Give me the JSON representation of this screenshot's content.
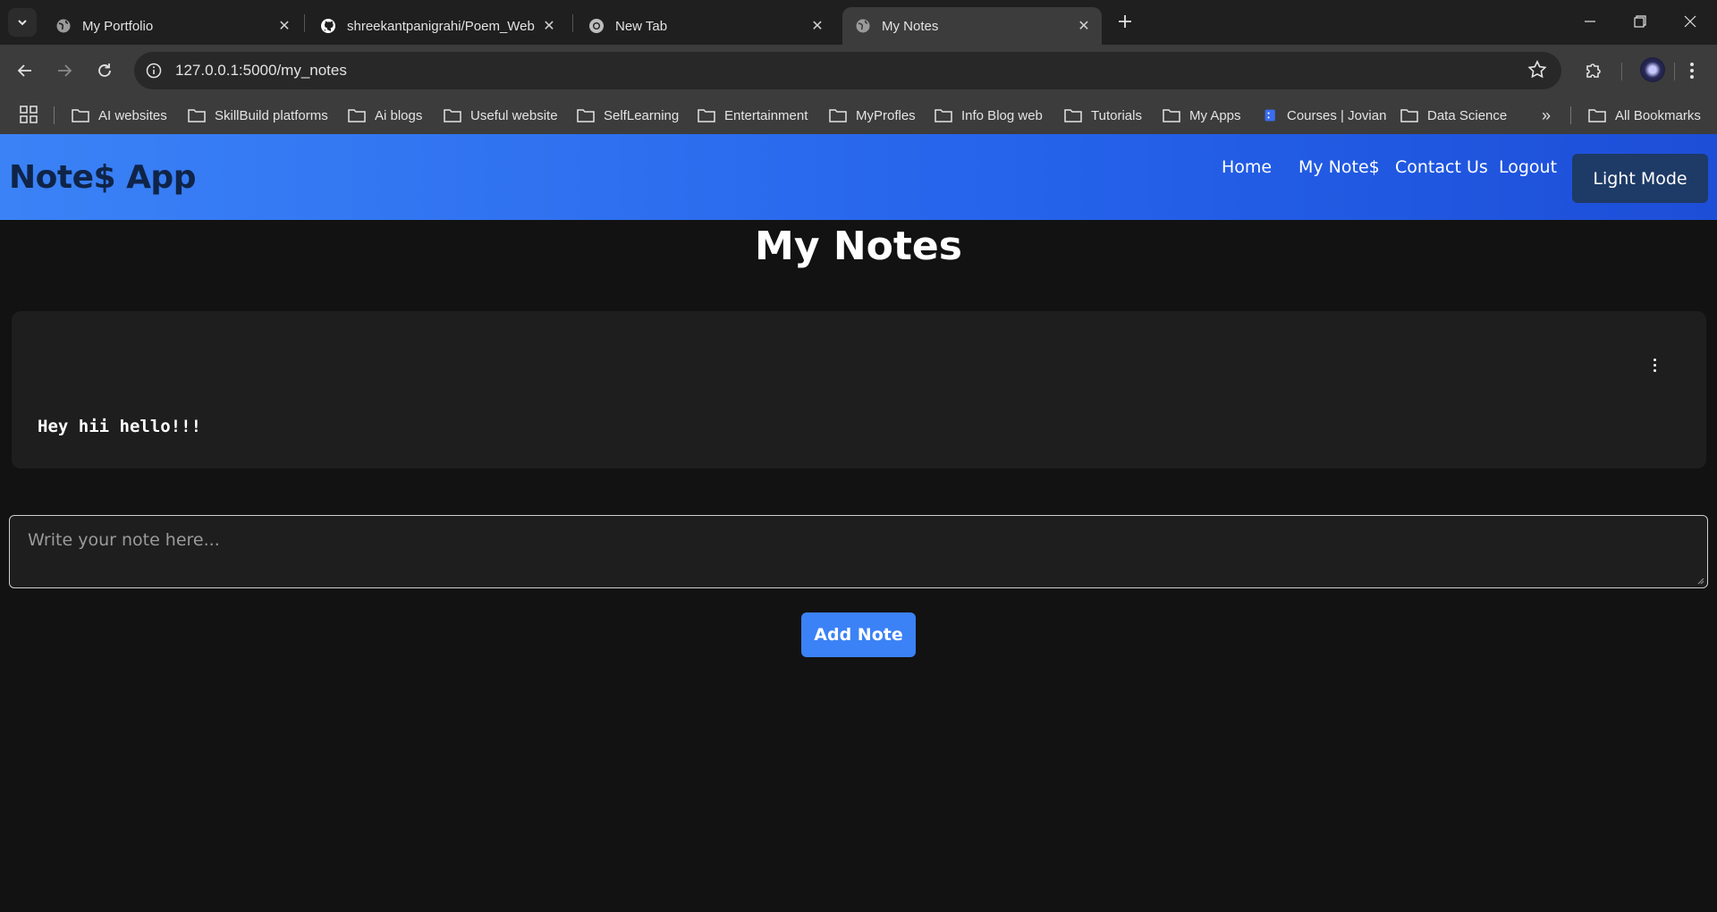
{
  "browser": {
    "tabs": [
      {
        "title": "My Portfolio",
        "active": false
      },
      {
        "title": "shreekantpanigrahi/Poem_Web",
        "active": false
      },
      {
        "title": "New Tab",
        "active": false
      },
      {
        "title": "My Notes",
        "active": true
      }
    ],
    "url": "127.0.0.1:5000/my_notes",
    "bookmarks": [
      {
        "label": "AI websites",
        "icon": "folder-icon"
      },
      {
        "label": "SkillBuild platforms",
        "icon": "folder-icon"
      },
      {
        "label": "Ai blogs",
        "icon": "folder-icon"
      },
      {
        "label": "Useful website",
        "icon": "folder-icon"
      },
      {
        "label": "SelfLearning",
        "icon": "folder-icon"
      },
      {
        "label": "Entertainment",
        "icon": "folder-icon"
      },
      {
        "label": "MyProfles",
        "icon": "folder-icon"
      },
      {
        "label": "Info Blog web",
        "icon": "folder-icon"
      },
      {
        "label": "Tutorials",
        "icon": "folder-icon"
      },
      {
        "label": "My Apps",
        "icon": "folder-icon"
      },
      {
        "label": "Courses | Jovian",
        "icon": "jovian-icon"
      },
      {
        "label": "Data Science",
        "icon": "folder-icon"
      }
    ],
    "more_bookmarks": "»",
    "all_bookmarks": "All Bookmarks"
  },
  "app": {
    "brand": "Note$ App",
    "nav": {
      "home": "Home",
      "my_notes": "My Note$",
      "contact": "Contact Us",
      "logout": "Logout"
    },
    "theme_button": "Light Mode",
    "page_title": "My Notes",
    "notes": [
      {
        "text": "Hey hii hello!!!"
      }
    ],
    "input": {
      "placeholder": "Write your note here...",
      "value": ""
    },
    "add_button": "Add Note"
  },
  "colors": {
    "navbar_start": "#3b82f6",
    "navbar_end": "#1d4ed8",
    "brand_text": "#0f2447",
    "theme_button_bg": "#1e3a66",
    "add_button_bg": "#3b82f6",
    "page_bg": "#121212",
    "card_bg": "#1e1e1e"
  }
}
